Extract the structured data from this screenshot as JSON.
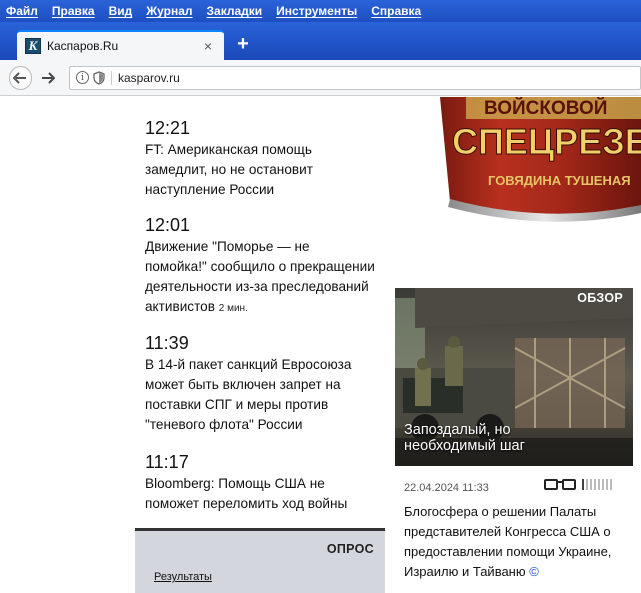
{
  "menu": {
    "items": [
      "Файл",
      "Правка",
      "Вид",
      "Журнал",
      "Закладки",
      "Инструменты",
      "Справка"
    ]
  },
  "tabs": {
    "active": {
      "title": "Каспаров.Ru",
      "favicon_letter": "K",
      "close": "×"
    },
    "new_tab": "+"
  },
  "nav": {
    "url": "kasparov.ru",
    "back_icon": "arrow-left-icon",
    "forward_icon": "arrow-right-icon",
    "info_icon": "info-icon",
    "shield_icon": "shield-icon"
  },
  "feed": {
    "items": [
      {
        "time": "12:21",
        "headline": "FT: Американская помощь замедлит, но не остановит наступление России",
        "ago": ""
      },
      {
        "time": "12:01",
        "headline": "Движение \"Поморье — не помойка!\" сообщило о прекращении деятельности из-за преследований активистов",
        "ago": "2 мин."
      },
      {
        "time": "11:39",
        "headline": "В 14-й пакет санкций Евросоюза может быть включен запрет на поставки СПГ и меры против \"теневого флота\" России",
        "ago": ""
      },
      {
        "time": "11:17",
        "headline": "Bloomberg: Помощь США не поможет переломить ход войны",
        "ago": ""
      }
    ]
  },
  "ad": {
    "line1": "ВОЙСКОВОЙ",
    "line2": "СПЕЦРЕЗЕ",
    "line3": "ГОВЯДИНА ТУШЕНАЯ"
  },
  "obzor": {
    "label": "ОБЗОР",
    "title": "Запоздалый, но необходимый шаг",
    "date": "22.04.2024 11:33",
    "rating_filled": 1,
    "rating_total": 8,
    "text": "Блогосфера о решении Палаты представителей Конгресса США о предоставлении помощи Украине, Израилю и Тайваню",
    "copy": "©"
  },
  "poll": {
    "label": "ОПРОС",
    "results_link": "Результаты"
  },
  "colors": {
    "menu_bg": "#2a63d8",
    "toolbar_bg": "#f5f6f7",
    "poll_bg": "#d3d6dc",
    "link_blue": "#1b4fc2"
  }
}
